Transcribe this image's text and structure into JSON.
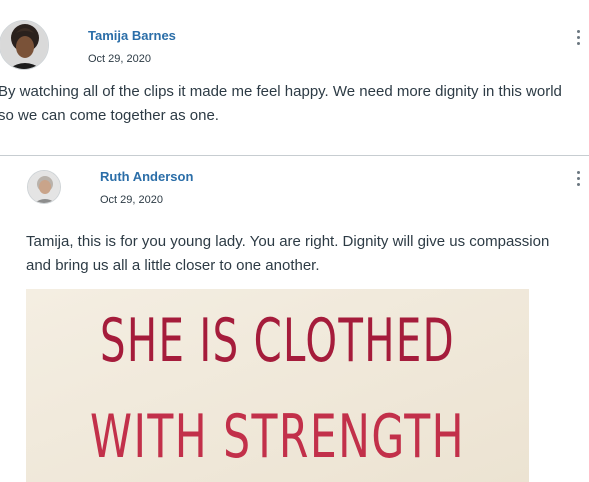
{
  "post": {
    "author": "Tamija Barnes",
    "date": "Oct 29, 2020",
    "line1": "By watching all of the clips it made me feel happy. We need more dignity in this world",
    "line2": "so we can come together as one."
  },
  "reply": {
    "author": "Ruth Anderson",
    "date": "Oct 29, 2020",
    "line1": "Tamija, this is for you young lady. You are right. Dignity will give us compassion",
    "line2": "and bring us all a little closer to one another.",
    "image_text": {
      "line1": "SHE IS CLOTHED",
      "line2": "WITH STRENGTH"
    }
  },
  "icons": {
    "post_menu": "more-vertical-icon",
    "reply_menu": "more-vertical-icon"
  },
  "colors": {
    "author_link": "#2b6ea8",
    "body_text": "#2d3b45"
  }
}
